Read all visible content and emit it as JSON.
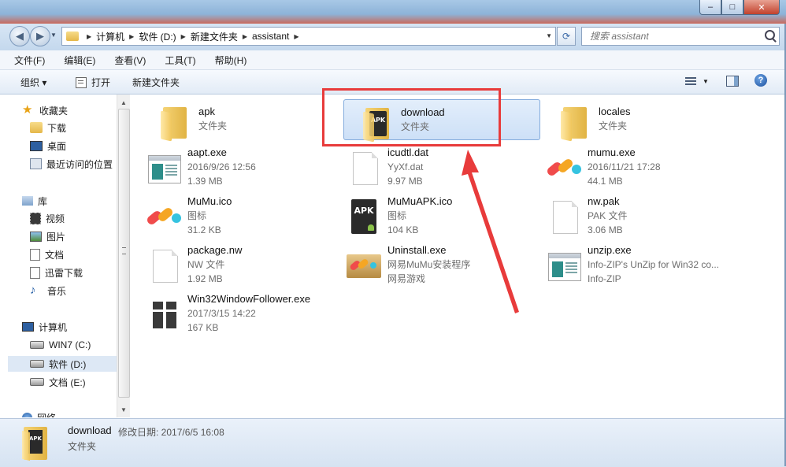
{
  "window": {
    "min_label": "–",
    "max_label": "□",
    "close_label": "✕"
  },
  "nav": {
    "breadcrumbs": [
      "计算机",
      "软件 (D:)",
      "新建文件夹",
      "assistant"
    ],
    "search_placeholder": "搜索 assistant",
    "back_glyph": "◀",
    "forward_glyph": "▶",
    "refresh_glyph": "⟳"
  },
  "menubar": {
    "items": [
      "文件(F)",
      "编辑(E)",
      "查看(V)",
      "工具(T)",
      "帮助(H)"
    ]
  },
  "toolbar": {
    "organize_label": "组织 ▾",
    "open_label": "打开",
    "new_folder_label": "新建文件夹",
    "help_glyph": "?"
  },
  "sidebar": {
    "groups": [
      {
        "label": "收藏夹",
        "icon": "star-icon",
        "items": [
          {
            "label": "下载",
            "icon": "download-folder-icon"
          },
          {
            "label": "桌面",
            "icon": "desktop-icon"
          },
          {
            "label": "最近访问的位置",
            "icon": "recent-places-icon"
          }
        ]
      },
      {
        "label": "库",
        "icon": "library-icon",
        "items": [
          {
            "label": "视频",
            "icon": "video-icon"
          },
          {
            "label": "图片",
            "icon": "picture-icon"
          },
          {
            "label": "文档",
            "icon": "document-icon"
          },
          {
            "label": "迅雷下载",
            "icon": "thunder-download-icon"
          },
          {
            "label": "音乐",
            "icon": "music-icon"
          }
        ]
      },
      {
        "label": "计算机",
        "icon": "computer-icon",
        "items": [
          {
            "label": "WIN7 (C:)",
            "icon": "system-drive-icon"
          },
          {
            "label": "软件 (D:)",
            "icon": "drive-icon",
            "selected": true
          },
          {
            "label": "文档 (E:)",
            "icon": "drive-icon"
          }
        ]
      },
      {
        "label": "网络",
        "icon": "network-icon",
        "items": []
      }
    ]
  },
  "files": [
    {
      "name": "apk",
      "line2": "文件夹",
      "line3": "",
      "icon": "folder-icon"
    },
    {
      "name": "download",
      "line2": "文件夹",
      "line3": "",
      "icon": "apk-folder-icon",
      "selected": true
    },
    {
      "name": "locales",
      "line2": "文件夹",
      "line3": "",
      "icon": "folder-icon"
    },
    {
      "name": "aapt.exe",
      "line2": "2016/9/26 12:56",
      "line3": "1.39 MB",
      "icon": "exe-window-icon"
    },
    {
      "name": "icudtl.dat",
      "line2": "YyXf.dat",
      "line3": "9.97 MB",
      "icon": "blank-file-icon"
    },
    {
      "name": "mumu.exe",
      "line2": "2016/11/21 17:28",
      "line3": "44.1 MB",
      "icon": "mumu-logo-icon"
    },
    {
      "name": "MuMu.ico",
      "line2": "图标",
      "line3": "31.2 KB",
      "icon": "mumu-logo-icon"
    },
    {
      "name": "MuMuAPK.ico",
      "line2": "图标",
      "line3": "104 KB",
      "icon": "apk-dark-icon"
    },
    {
      "name": "nw.pak",
      "line2": "PAK 文件",
      "line3": "3.06 MB",
      "icon": "blank-file-icon"
    },
    {
      "name": "package.nw",
      "line2": "NW 文件",
      "line3": "1.92 MB",
      "icon": "blank-file-icon"
    },
    {
      "name": "Uninstall.exe",
      "line2": "网易MuMu安装程序",
      "line3": "网易游戏",
      "icon": "installer-box-icon"
    },
    {
      "name": "unzip.exe",
      "line2": "Info-ZIP's UnZip for Win32 co...",
      "line3": "Info-ZIP",
      "icon": "exe-window-icon"
    },
    {
      "name": "Win32WindowFollower.exe",
      "line2": "2017/3/15 14:22",
      "line3": "167 KB",
      "icon": "gift-box-icon"
    }
  ],
  "details": {
    "name": "download",
    "modified_label": "修改日期: 2017/6/5 16:08",
    "type": "文件夹"
  },
  "colors": {
    "annotation_red": "#e83b3b",
    "selection_blue": "#cde0f7"
  }
}
